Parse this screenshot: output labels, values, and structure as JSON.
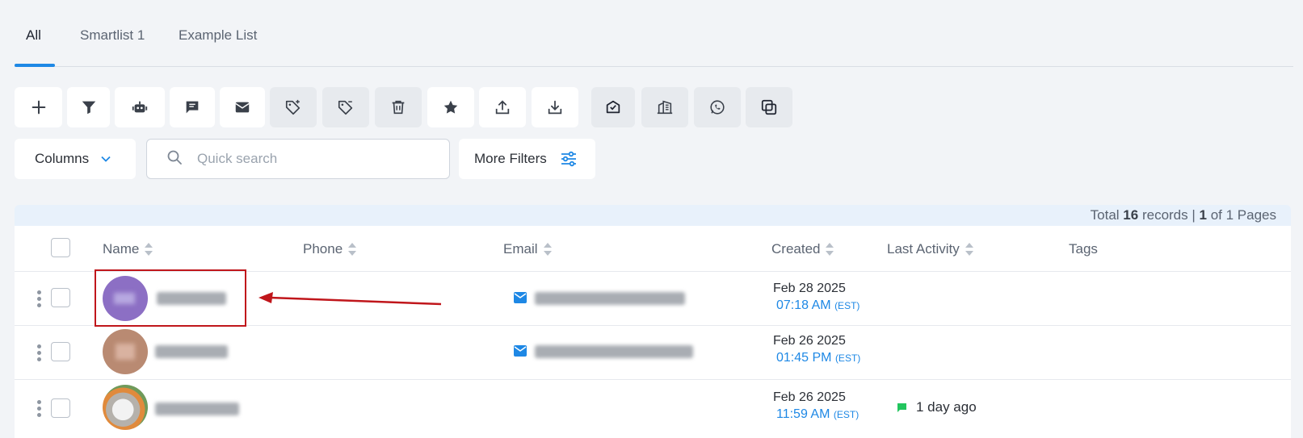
{
  "tabs": [
    {
      "label": "All",
      "active": true
    },
    {
      "label": "Smartlist 1",
      "active": false
    },
    {
      "label": "Example List",
      "active": false
    }
  ],
  "toolbar": {
    "buttons": [
      {
        "icon": "plus-icon"
      },
      {
        "icon": "filter-icon"
      },
      {
        "icon": "robot-icon"
      },
      {
        "icon": "chat-icon"
      },
      {
        "icon": "mail-icon"
      },
      {
        "icon": "tag-add-icon"
      },
      {
        "icon": "tag-remove-icon"
      },
      {
        "icon": "trash-icon"
      },
      {
        "icon": "star-icon"
      },
      {
        "icon": "upload-icon"
      },
      {
        "icon": "download-icon"
      },
      {
        "icon": "mail-verify-icon"
      },
      {
        "icon": "building-icon"
      },
      {
        "icon": "whatsapp-icon"
      },
      {
        "icon": "merge-icon"
      }
    ]
  },
  "filters": {
    "columns_label": "Columns",
    "search_placeholder": "Quick search",
    "search_value": "",
    "more_filters_label": "More Filters"
  },
  "records": {
    "prefix": "Total",
    "total": "16",
    "middle": "records |",
    "page": "1",
    "suffix": "of 1 Pages"
  },
  "table": {
    "headers": {
      "name": "Name",
      "phone": "Phone",
      "email": "Email",
      "created": "Created",
      "last_activity": "Last Activity",
      "tags": "Tags"
    },
    "rows": [
      {
        "created_date": "Feb 28 2025",
        "created_time": "07:18 AM",
        "tz": "(EST)",
        "activity": "",
        "avatar_color": "#8c6fc4"
      },
      {
        "created_date": "Feb 26 2025",
        "created_time": "01:45 PM",
        "tz": "(EST)",
        "activity": "",
        "avatar_color": "#b98a72"
      },
      {
        "created_date": "Feb 26 2025",
        "created_time": "11:59 AM",
        "tz": "(EST)",
        "activity": "1 day ago",
        "avatar_color": "#d9c9b6"
      }
    ]
  },
  "colors": {
    "accent": "#1e88e5",
    "highlight": "#c0161b",
    "activity_chat": "#22c55e"
  }
}
